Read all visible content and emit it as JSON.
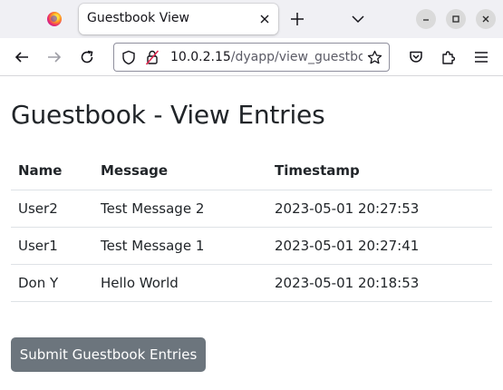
{
  "browser": {
    "tab_title": "Guestbook View",
    "url_host": "10.0.2.15",
    "url_path": "/dyapp/view_guestbook"
  },
  "page": {
    "title": "Guestbook - View Entries",
    "table": {
      "headers": [
        "Name",
        "Message",
        "Timestamp"
      ],
      "rows": [
        {
          "name": "User2",
          "message": "Test Message 2",
          "timestamp": "2023-05-01 20:27:53"
        },
        {
          "name": "User1",
          "message": "Test Message 1",
          "timestamp": "2023-05-01 20:27:41"
        },
        {
          "name": "Don Y",
          "message": "Hello World",
          "timestamp": "2023-05-01 20:18:53"
        }
      ]
    },
    "submit_button_label": "Submit Guestbook Entries"
  },
  "icons": {
    "firefox": "firefox-icon",
    "tab_close": "close-icon",
    "new_tab": "plus-icon",
    "list_tabs": "chevron-down-icon",
    "minimize": "minimize-icon",
    "maximize": "maximize-icon",
    "close_window": "close-icon",
    "back": "back-arrow-icon",
    "forward": "forward-arrow-icon",
    "reload": "reload-icon",
    "tracking_protection": "shield-icon",
    "insecure": "insecure-lock-icon",
    "bookmark": "star-icon",
    "pocket": "pocket-icon",
    "extensions": "puzzle-icon",
    "menu": "hamburger-menu-icon"
  },
  "colors": {
    "button_bg": "#6c757d",
    "text": "#212529",
    "tabstrip_bg": "#f0f0f4"
  }
}
